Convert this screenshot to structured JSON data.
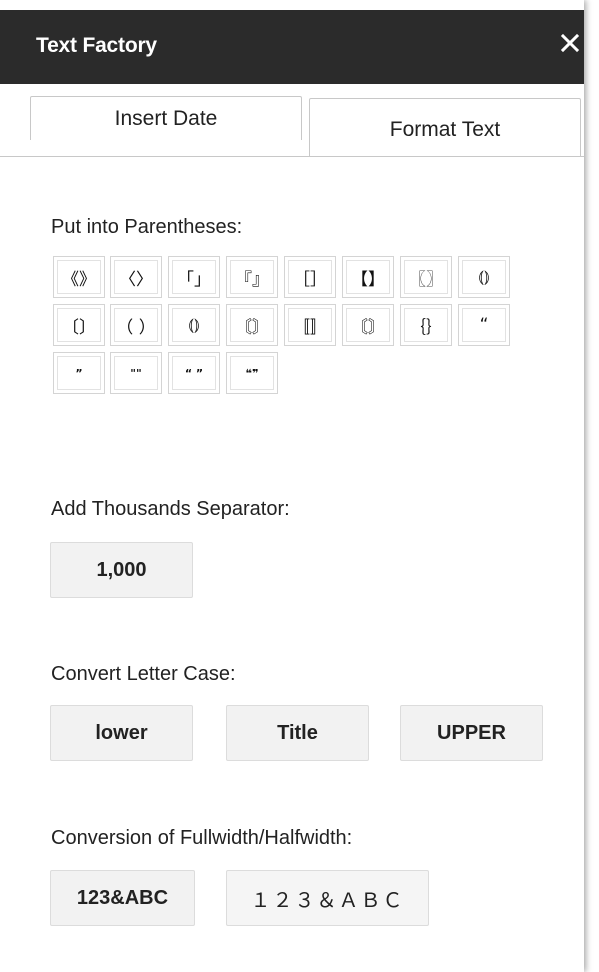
{
  "window": {
    "title": "Text Factory"
  },
  "tabs": [
    {
      "label": "Insert Date",
      "active": false
    },
    {
      "label": "Format Text",
      "active": true
    }
  ],
  "parentheses": {
    "label": "Put into Parentheses:",
    "buttons": [
      "《》",
      "〈〉",
      "「」",
      "『』",
      "［］",
      "【】",
      "〖〗",
      "⦅⦆",
      "〔〕",
      "（ ）",
      "⦅⦆",
      "〘〙",
      "〚〛",
      "〘〙",
      "｛｝",
      "“",
      "”",
      "\"\"",
      "“ ”",
      "❝❞"
    ]
  },
  "thousands": {
    "label": "Add Thousands Separator:",
    "button": "1,000"
  },
  "lettercase": {
    "label": "Convert Letter Case:",
    "buttons": [
      "lower",
      "Title",
      "UPPER"
    ]
  },
  "width_conv": {
    "label": "Conversion of Fullwidth/Halfwidth:",
    "buttons": [
      "123&ABC",
      "１２３＆ＡＢＣ"
    ]
  },
  "colors": {
    "titlebar": "#2b2b2b",
    "button_bg": "#f2f2f2",
    "border": "#d4d4d4"
  },
  "icons": {
    "close": "close-icon"
  }
}
